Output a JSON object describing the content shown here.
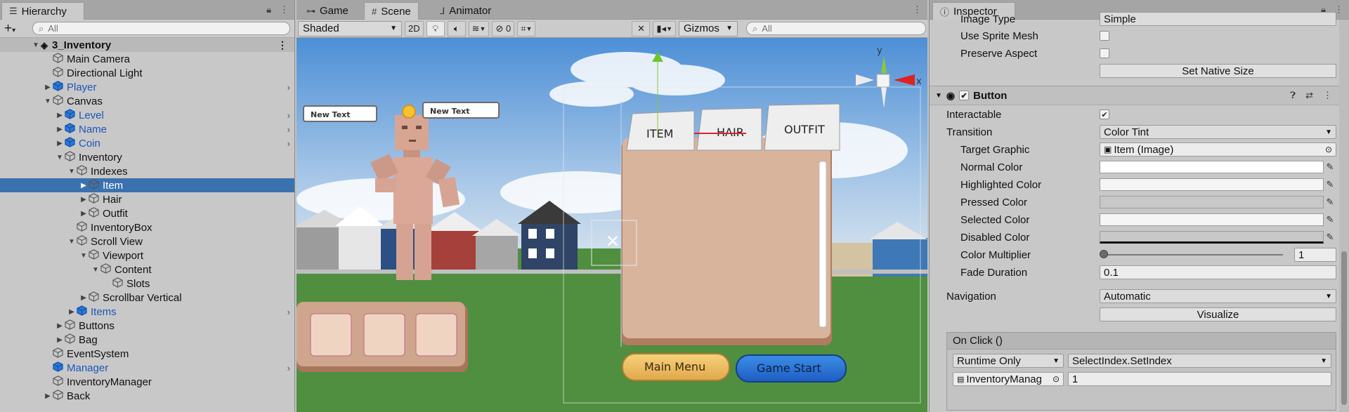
{
  "hierarchy": {
    "tab_label": "Hierarchy",
    "search_placeholder": "All",
    "rows": [
      {
        "label": "3_Inventory",
        "indent": 0,
        "arrow": "▼",
        "kind": "scene"
      },
      {
        "label": "Main Camera",
        "indent": 1,
        "arrow": "",
        "kind": "object"
      },
      {
        "label": "Directional Light",
        "indent": 1,
        "arrow": "",
        "kind": "object"
      },
      {
        "label": "Player",
        "indent": 1,
        "arrow": "▶",
        "kind": "prefab",
        "more": true
      },
      {
        "label": "Canvas",
        "indent": 1,
        "arrow": "▼",
        "kind": "object"
      },
      {
        "label": "Level",
        "indent": 2,
        "arrow": "▶",
        "kind": "prefab",
        "more": true
      },
      {
        "label": "Name",
        "indent": 2,
        "arrow": "▶",
        "kind": "prefab",
        "more": true
      },
      {
        "label": "Coin",
        "indent": 2,
        "arrow": "▶",
        "kind": "prefab",
        "more": true
      },
      {
        "label": "Inventory",
        "indent": 2,
        "arrow": "▼",
        "kind": "object"
      },
      {
        "label": "Indexes",
        "indent": 3,
        "arrow": "▼",
        "kind": "object"
      },
      {
        "label": "Item",
        "indent": 4,
        "arrow": "▶",
        "kind": "object",
        "selected": true
      },
      {
        "label": "Hair",
        "indent": 4,
        "arrow": "▶",
        "kind": "object"
      },
      {
        "label": "Outfit",
        "indent": 4,
        "arrow": "▶",
        "kind": "object"
      },
      {
        "label": "InventoryBox",
        "indent": 3,
        "arrow": "",
        "kind": "object"
      },
      {
        "label": "Scroll View",
        "indent": 3,
        "arrow": "▼",
        "kind": "object"
      },
      {
        "label": "Viewport",
        "indent": 4,
        "arrow": "▼",
        "kind": "object"
      },
      {
        "label": "Content",
        "indent": 5,
        "arrow": "▼",
        "kind": "object"
      },
      {
        "label": "Slots",
        "indent": 6,
        "arrow": "",
        "kind": "object"
      },
      {
        "label": "Scrollbar Vertical",
        "indent": 4,
        "arrow": "▶",
        "kind": "object"
      },
      {
        "label": "Items",
        "indent": 3,
        "arrow": "▶",
        "kind": "prefab",
        "more": true
      },
      {
        "label": "Buttons",
        "indent": 2,
        "arrow": "▶",
        "kind": "object"
      },
      {
        "label": "Bag",
        "indent": 2,
        "arrow": "▶",
        "kind": "object"
      },
      {
        "label": "EventSystem",
        "indent": 1,
        "arrow": "",
        "kind": "object"
      },
      {
        "label": "Manager",
        "indent": 1,
        "arrow": "",
        "kind": "prefab",
        "more": true
      },
      {
        "label": "InventoryManager",
        "indent": 1,
        "arrow": "",
        "kind": "object"
      },
      {
        "label": "Back",
        "indent": 1,
        "arrow": "▶",
        "kind": "object"
      }
    ]
  },
  "scene_view": {
    "tabs": [
      {
        "label": "Game",
        "icon": "gamepad-icon"
      },
      {
        "label": "Scene",
        "icon": "grid-icon"
      },
      {
        "label": "Animator",
        "icon": "animator-icon"
      }
    ],
    "draw_mode": "Shaded",
    "mode_2d": "2D",
    "hidden_count": "0",
    "gizmos_label": "Gizmos",
    "search_placeholder": "All",
    "canvas_texts": {
      "new_text_1": "New Text",
      "new_text_2": "New Text",
      "tab_item": "ITEM",
      "tab_hair": "HAIR",
      "tab_outfit": "OUTFIT",
      "btn_main_menu": "Main Menu",
      "btn_game_start": "Game Start"
    },
    "gizmo_axes": {
      "x": "x",
      "y": "y"
    }
  },
  "inspector": {
    "tab_label": "Inspector",
    "image_type_label": "Image Type",
    "image_type_value": "Simple",
    "use_sprite_mesh_label": "Use Sprite Mesh",
    "preserve_aspect_label": "Preserve Aspect",
    "set_native_size_label": "Set Native Size",
    "component_name": "Button",
    "interactable_label": "Interactable",
    "transition_label": "Transition",
    "transition_value": "Color Tint",
    "target_graphic_label": "Target Graphic",
    "target_graphic_value": "Item (Image)",
    "normal_color_label": "Normal Color",
    "highlighted_color_label": "Highlighted Color",
    "pressed_color_label": "Pressed Color",
    "selected_color_label": "Selected Color",
    "disabled_color_label": "Disabled Color",
    "color_multiplier_label": "Color Multiplier",
    "color_multiplier_value": "1",
    "fade_duration_label": "Fade Duration",
    "fade_duration_value": "0.1",
    "navigation_label": "Navigation",
    "navigation_value": "Automatic",
    "visualize_label": "Visualize",
    "onclick_label": "On Click ()",
    "runtime_value": "Runtime Only",
    "function_value": "SelectIndex.SetIndex",
    "object_value": "InventoryManag",
    "argument_value": "1",
    "add_label": "+",
    "remove_label": "−"
  },
  "colors": {
    "selection": "#3a72b0",
    "prefab_text": "#1d56b8",
    "normal_color": "#ffffff",
    "pressed_color": "#c8c8c8",
    "disabled_color": "#c8c8c8"
  }
}
